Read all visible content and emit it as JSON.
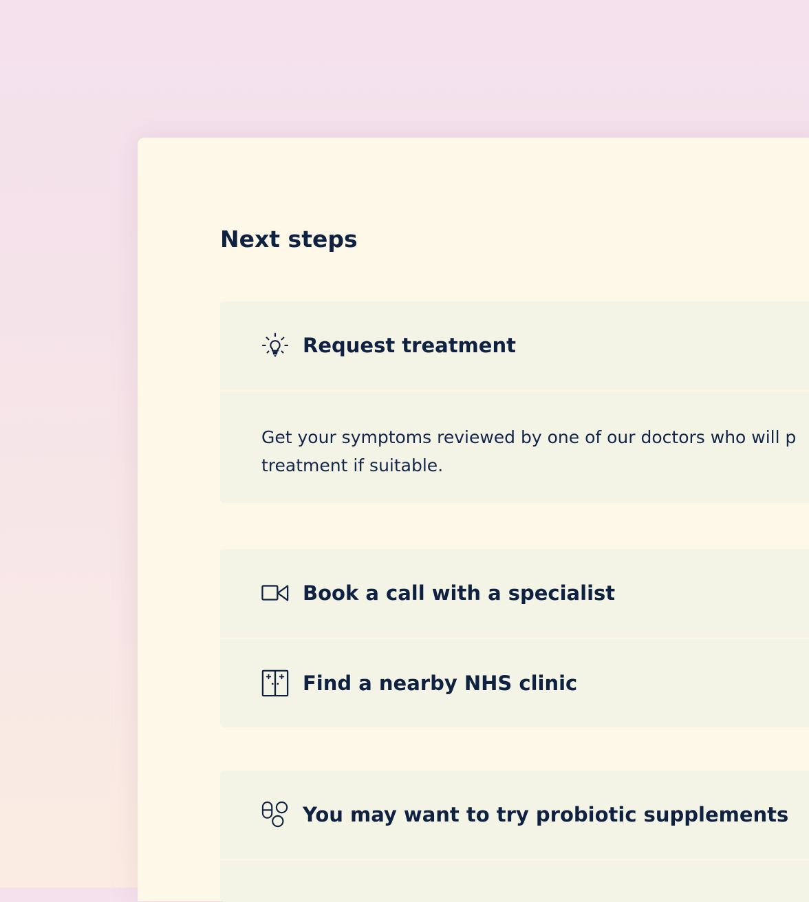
{
  "section": {
    "title": "Next steps"
  },
  "cards": [
    {
      "rows": [
        {
          "title": "Request treatment",
          "icon": "lightbulb-icon"
        }
      ],
      "body": {
        "line1": "Get your symptoms reviewed by one of our doctors who will p",
        "line2": "treatment if suitable."
      }
    },
    {
      "rows": [
        {
          "title": "Book a call with a specialist",
          "icon": "video-camera-icon"
        },
        {
          "title": "Find a nearby NHS clinic",
          "icon": "hospital-door-icon"
        }
      ]
    },
    {
      "rows": [
        {
          "title": "You may want to try probiotic supplements",
          "icon": "pills-icon"
        }
      ]
    }
  ],
  "colors": {
    "text": "#0f2140",
    "panel": "#fdf8e7",
    "card": "#f3f3e6"
  }
}
